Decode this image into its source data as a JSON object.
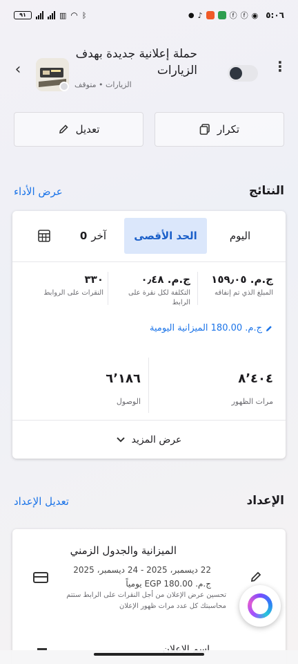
{
  "status_bar": {
    "battery": "٩١",
    "time": "٥:٠٦",
    "app_icons": [
      "tiktok-icon",
      "app-orange-icon",
      "app-green-icon",
      "facebook-icon",
      "facebook-icon",
      "chrome-icon"
    ]
  },
  "header": {
    "title": "حملة إعلانية جديدة بهدف الزيارات",
    "subtitle": "الزيارات • متوقف",
    "toggle_on": false
  },
  "actions": {
    "duplicate_label": "تكرار",
    "edit_label": "تعديل"
  },
  "results": {
    "section_title": "النتائج",
    "view_performance_link": "عرض الأداء",
    "ranges": {
      "today": "اليوم",
      "max": "الحد الأقصى",
      "last_prefix": "آخر",
      "last_value": "0"
    },
    "metrics": {
      "spent_value": "ج.م. ١٥٩٫٠٥",
      "spent_label": "المبلغ الذي تم إنفاقه",
      "cpc_value": "ج.م. ٠٫٤٨",
      "cpc_label": "التكلفة لكل نقرة على الرابط",
      "clicks_value": "٣٣٠",
      "clicks_label": "النقرات على الروابط"
    },
    "daily_budget": "ج.م. 180.00 الميزانية اليومية",
    "impressions_value": "٨٬٤٠٤",
    "impressions_label": "مرات الظهور",
    "reach_value": "٦٬١٨٦",
    "reach_label": "الوصول",
    "show_more": "عرض المزيد"
  },
  "setup": {
    "section_title": "الإعداد",
    "edit_setup_link": "تعديل الإعداد",
    "budget_title": "الميزانية والجدول الزمني",
    "dates": "22 ديسمبر، 2025 - 24 ديسمبر، 2025",
    "daily_amount": "ج.م. EGP 180.00 يومياً",
    "note": "تحسين عرض الإعلان من أجل النقرات على الرابط ستتم محاسبتك كل عدد مرات ظهور الإعلان",
    "ad_name_label": "اسم الإعلان"
  }
}
